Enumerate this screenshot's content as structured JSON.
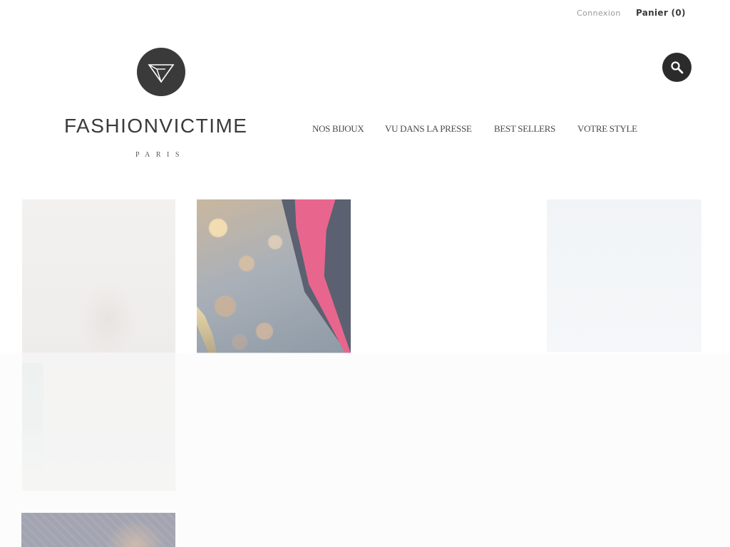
{
  "header": {
    "login_label": "Connexion",
    "cart_label": "Panier (0)",
    "search_icon": "search-icon"
  },
  "logo": {
    "emblem_icon": "diamond-icon",
    "name": "FASHIONVICTIME",
    "city": "PARIS"
  },
  "nav": {
    "items": [
      {
        "label": "NOS BIJOUX"
      },
      {
        "label": "VU DANS LA PRESSE"
      },
      {
        "label": "BEST SELLERS"
      },
      {
        "label": "VOTRE STYLE"
      }
    ]
  },
  "colors": {
    "brand_dark": "#3a3a3a",
    "accent_pink": "#e8668e"
  }
}
